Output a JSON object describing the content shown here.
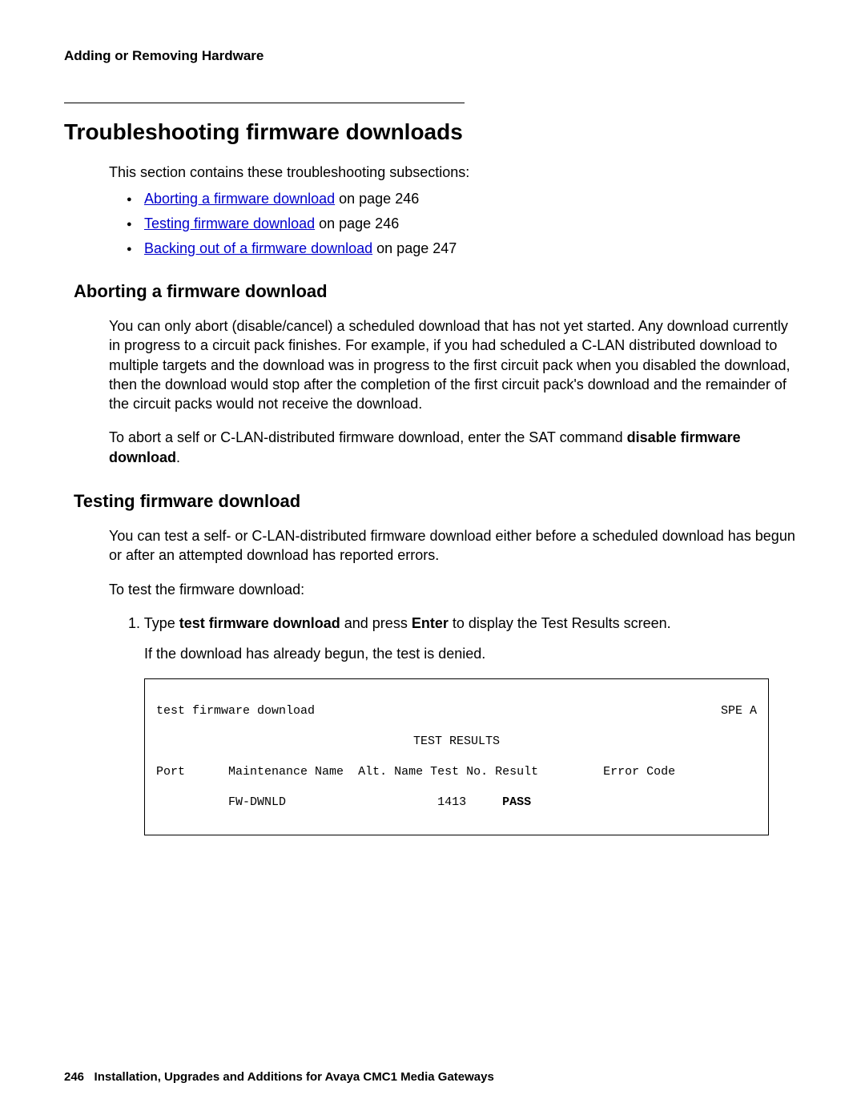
{
  "header": {
    "running_title": "Adding or Removing Hardware"
  },
  "main": {
    "title": "Troubleshooting firmware downloads",
    "intro": "This section contains these troubleshooting subsections:",
    "links": [
      {
        "text": "Aborting a firmware download",
        "suffix": " on page 246"
      },
      {
        "text": "Testing firmware download",
        "suffix": " on page 246"
      },
      {
        "text": "Backing out of a firmware download",
        "suffix": " on page 247"
      }
    ],
    "section1": {
      "heading": "Aborting a firmware download",
      "para1": "You can only abort (disable/cancel) a scheduled download that has not yet started. Any download currently in progress to a circuit pack finishes. For example, if you had scheduled a C-LAN distributed download to multiple targets and the download was in progress to the first circuit pack when you disabled the download, then the download would stop after the completion of the first circuit pack's download and the remainder of the circuit packs would not receive the download.",
      "para2_pre": "To abort a self or C-LAN-distributed firmware download, enter the SAT command ",
      "para2_bold": "disable firmware download",
      "para2_post": "."
    },
    "section2": {
      "heading": "Testing firmware download",
      "para1": "You can test a self- or C-LAN-distributed firmware download either before a scheduled download has begun or after an attempted download has reported errors.",
      "para2": "To test the firmware download:",
      "step1_pre": "1. Type ",
      "step1_bold1": "test firmware download",
      "step1_mid": " and press ",
      "step1_bold2": "Enter",
      "step1_post": " to display the Test Results screen.",
      "step1_note": "If the download has already begun, the test is denied."
    },
    "terminal": {
      "cmd": "test firmware download",
      "spe": "SPE A",
      "title": "TEST RESULTS",
      "col_port": "Port",
      "col_maint": "Maintenance Name",
      "col_alt": "Alt. Name",
      "col_test": "Test No.",
      "col_result": "Result",
      "col_error": "Error Code",
      "data_maint": "FW-DWNLD",
      "data_test": "1413",
      "data_result": "PASS"
    }
  },
  "footer": {
    "page_number": "246",
    "doc_title": "Installation, Upgrades and Additions for Avaya CMC1 Media Gateways"
  }
}
